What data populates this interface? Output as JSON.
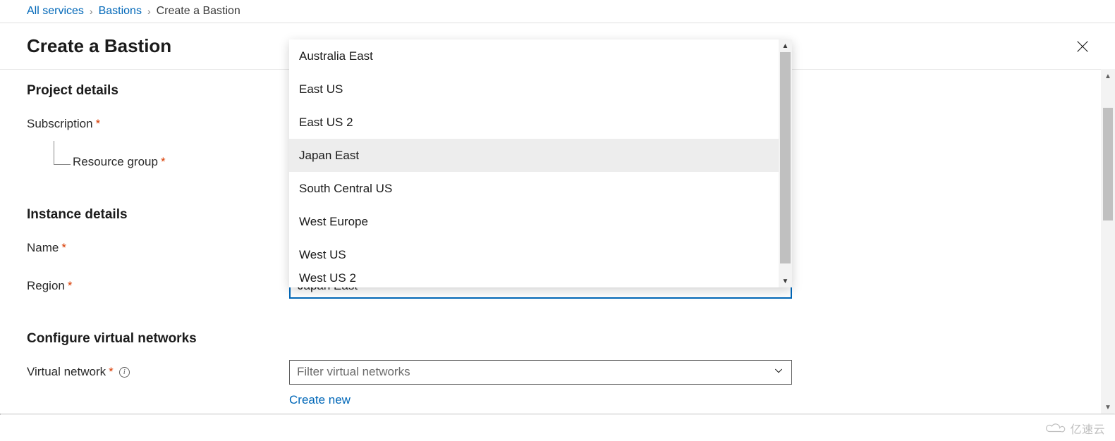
{
  "breadcrumb": {
    "items": [
      "All services",
      "Bastions",
      "Create a Bastion"
    ]
  },
  "page": {
    "title": "Create a Bastion"
  },
  "sections": {
    "project": {
      "title": "Project details",
      "subscription_label": "Subscription",
      "resource_group_label": "Resource group"
    },
    "instance": {
      "title": "Instance details",
      "name_label": "Name",
      "region_label": "Region",
      "region_value": "Japan East"
    },
    "vnet": {
      "title": "Configure virtual networks",
      "vnet_label": "Virtual network",
      "vnet_placeholder": "Filter virtual networks",
      "create_new_label": "Create new"
    }
  },
  "region_dropdown": {
    "options": [
      {
        "label": "Australia East",
        "hover": false
      },
      {
        "label": "East US",
        "hover": false
      },
      {
        "label": "East US 2",
        "hover": false
      },
      {
        "label": "Japan East",
        "hover": true
      },
      {
        "label": "South Central US",
        "hover": false
      },
      {
        "label": "West Europe",
        "hover": false
      },
      {
        "label": "West US",
        "hover": false
      },
      {
        "label": "West US 2",
        "hover": false
      }
    ]
  },
  "watermark": "亿速云"
}
